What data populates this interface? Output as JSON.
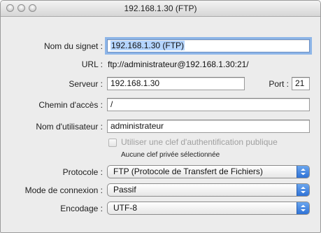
{
  "window": {
    "title": "192.168.1.30 (FTP)"
  },
  "form": {
    "bookmark_label": "Nom du signet :",
    "bookmark_value": "192.168.1.30 (FTP)",
    "url_label": "URL :",
    "url_value": "ftp://administrateur@192.168.1.30:21/",
    "server_label": "Serveur :",
    "server_value": "192.168.1.30",
    "port_label": "Port :",
    "port_value": "21",
    "path_label": "Chemin d'accès :",
    "path_value": "/",
    "username_label": "Nom d'utilisateur :",
    "username_value": "administrateur",
    "pubkey_label": "Utiliser une clef d'authentification publique",
    "pubkey_checked": false,
    "pubkey_note": "Aucune clef privée sélectionnée",
    "protocol_label": "Protocole :",
    "protocol_value": "FTP (Protocole de Transfert de Fichiers)",
    "connection_mode_label": "Mode de connexion :",
    "connection_mode_value": "Passif",
    "encoding_label": "Encodage :",
    "encoding_value": "UTF-8"
  },
  "colors": {
    "focus_ring": "#8eb6e8",
    "popup_arrow": "#2f72d6",
    "window_bg": "#ececec"
  },
  "icons": {
    "traffic_lights": [
      "close-button-icon",
      "minimize-button-icon",
      "zoom-button-icon"
    ],
    "popup_arrows": "up-down-chevron-icon"
  }
}
